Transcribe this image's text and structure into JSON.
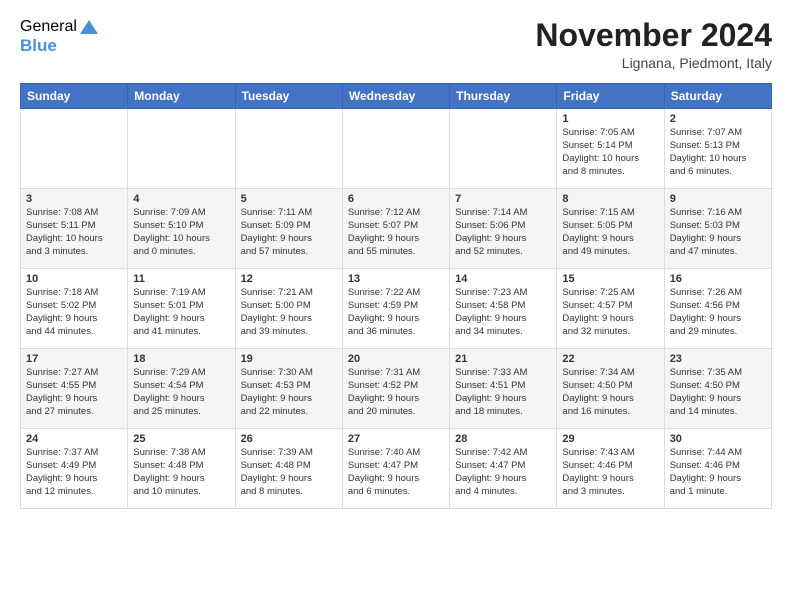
{
  "logo": {
    "general": "General",
    "blue": "Blue"
  },
  "title": "November 2024",
  "location": "Lignana, Piedmont, Italy",
  "days_of_week": [
    "Sunday",
    "Monday",
    "Tuesday",
    "Wednesday",
    "Thursday",
    "Friday",
    "Saturday"
  ],
  "weeks": [
    [
      {
        "day": "",
        "info": ""
      },
      {
        "day": "",
        "info": ""
      },
      {
        "day": "",
        "info": ""
      },
      {
        "day": "",
        "info": ""
      },
      {
        "day": "",
        "info": ""
      },
      {
        "day": "1",
        "info": "Sunrise: 7:05 AM\nSunset: 5:14 PM\nDaylight: 10 hours\nand 8 minutes."
      },
      {
        "day": "2",
        "info": "Sunrise: 7:07 AM\nSunset: 5:13 PM\nDaylight: 10 hours\nand 6 minutes."
      }
    ],
    [
      {
        "day": "3",
        "info": "Sunrise: 7:08 AM\nSunset: 5:11 PM\nDaylight: 10 hours\nand 3 minutes."
      },
      {
        "day": "4",
        "info": "Sunrise: 7:09 AM\nSunset: 5:10 PM\nDaylight: 10 hours\nand 0 minutes."
      },
      {
        "day": "5",
        "info": "Sunrise: 7:11 AM\nSunset: 5:09 PM\nDaylight: 9 hours\nand 57 minutes."
      },
      {
        "day": "6",
        "info": "Sunrise: 7:12 AM\nSunset: 5:07 PM\nDaylight: 9 hours\nand 55 minutes."
      },
      {
        "day": "7",
        "info": "Sunrise: 7:14 AM\nSunset: 5:06 PM\nDaylight: 9 hours\nand 52 minutes."
      },
      {
        "day": "8",
        "info": "Sunrise: 7:15 AM\nSunset: 5:05 PM\nDaylight: 9 hours\nand 49 minutes."
      },
      {
        "day": "9",
        "info": "Sunrise: 7:16 AM\nSunset: 5:03 PM\nDaylight: 9 hours\nand 47 minutes."
      }
    ],
    [
      {
        "day": "10",
        "info": "Sunrise: 7:18 AM\nSunset: 5:02 PM\nDaylight: 9 hours\nand 44 minutes."
      },
      {
        "day": "11",
        "info": "Sunrise: 7:19 AM\nSunset: 5:01 PM\nDaylight: 9 hours\nand 41 minutes."
      },
      {
        "day": "12",
        "info": "Sunrise: 7:21 AM\nSunset: 5:00 PM\nDaylight: 9 hours\nand 39 minutes."
      },
      {
        "day": "13",
        "info": "Sunrise: 7:22 AM\nSunset: 4:59 PM\nDaylight: 9 hours\nand 36 minutes."
      },
      {
        "day": "14",
        "info": "Sunrise: 7:23 AM\nSunset: 4:58 PM\nDaylight: 9 hours\nand 34 minutes."
      },
      {
        "day": "15",
        "info": "Sunrise: 7:25 AM\nSunset: 4:57 PM\nDaylight: 9 hours\nand 32 minutes."
      },
      {
        "day": "16",
        "info": "Sunrise: 7:26 AM\nSunset: 4:56 PM\nDaylight: 9 hours\nand 29 minutes."
      }
    ],
    [
      {
        "day": "17",
        "info": "Sunrise: 7:27 AM\nSunset: 4:55 PM\nDaylight: 9 hours\nand 27 minutes."
      },
      {
        "day": "18",
        "info": "Sunrise: 7:29 AM\nSunset: 4:54 PM\nDaylight: 9 hours\nand 25 minutes."
      },
      {
        "day": "19",
        "info": "Sunrise: 7:30 AM\nSunset: 4:53 PM\nDaylight: 9 hours\nand 22 minutes."
      },
      {
        "day": "20",
        "info": "Sunrise: 7:31 AM\nSunset: 4:52 PM\nDaylight: 9 hours\nand 20 minutes."
      },
      {
        "day": "21",
        "info": "Sunrise: 7:33 AM\nSunset: 4:51 PM\nDaylight: 9 hours\nand 18 minutes."
      },
      {
        "day": "22",
        "info": "Sunrise: 7:34 AM\nSunset: 4:50 PM\nDaylight: 9 hours\nand 16 minutes."
      },
      {
        "day": "23",
        "info": "Sunrise: 7:35 AM\nSunset: 4:50 PM\nDaylight: 9 hours\nand 14 minutes."
      }
    ],
    [
      {
        "day": "24",
        "info": "Sunrise: 7:37 AM\nSunset: 4:49 PM\nDaylight: 9 hours\nand 12 minutes."
      },
      {
        "day": "25",
        "info": "Sunrise: 7:38 AM\nSunset: 4:48 PM\nDaylight: 9 hours\nand 10 minutes."
      },
      {
        "day": "26",
        "info": "Sunrise: 7:39 AM\nSunset: 4:48 PM\nDaylight: 9 hours\nand 8 minutes."
      },
      {
        "day": "27",
        "info": "Sunrise: 7:40 AM\nSunset: 4:47 PM\nDaylight: 9 hours\nand 6 minutes."
      },
      {
        "day": "28",
        "info": "Sunrise: 7:42 AM\nSunset: 4:47 PM\nDaylight: 9 hours\nand 4 minutes."
      },
      {
        "day": "29",
        "info": "Sunrise: 7:43 AM\nSunset: 4:46 PM\nDaylight: 9 hours\nand 3 minutes."
      },
      {
        "day": "30",
        "info": "Sunrise: 7:44 AM\nSunset: 4:46 PM\nDaylight: 9 hours\nand 1 minute."
      }
    ]
  ]
}
